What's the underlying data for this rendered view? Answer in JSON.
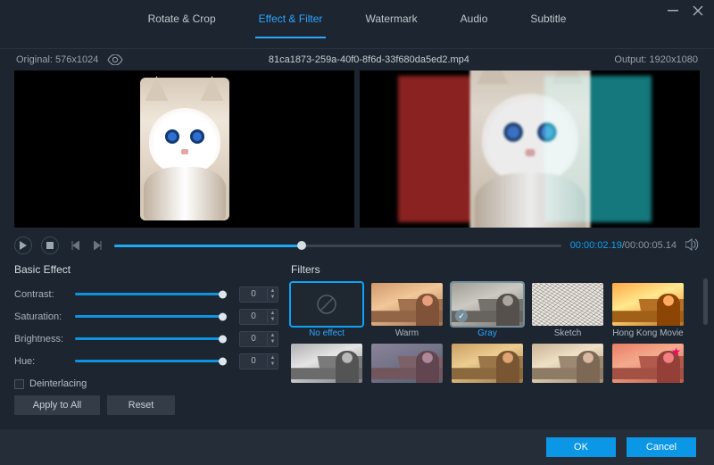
{
  "window": {
    "minimize": "—",
    "close": "✕"
  },
  "tabs": {
    "rotate": "Rotate & Crop",
    "effect": "Effect & Filter",
    "watermark": "Watermark",
    "audio": "Audio",
    "subtitle": "Subtitle"
  },
  "info": {
    "original_label": "Original: 576x1024",
    "filename": "81ca1873-259a-40f0-8f6d-33f680da5ed2.mp4",
    "output_label": "Output: 1920x1080"
  },
  "playback": {
    "current_time": "00:00:02.19",
    "total_time": "/00:00:05.14",
    "progress_pct": 42
  },
  "basic": {
    "title": "Basic Effect",
    "contrast_label": "Contrast:",
    "contrast_value": "0",
    "saturation_label": "Saturation:",
    "saturation_value": "0",
    "brightness_label": "Brightness:",
    "brightness_value": "0",
    "hue_label": "Hue:",
    "hue_value": "0",
    "deinterlacing_label": "Deinterlacing",
    "apply_label": "Apply to All",
    "reset_label": "Reset"
  },
  "filters": {
    "title": "Filters",
    "noeffect": "No effect",
    "warm": "Warm",
    "gray": "Gray",
    "sketch": "Sketch",
    "hkm": "Hong Kong Movie"
  },
  "footer": {
    "ok": "OK",
    "cancel": "Cancel"
  }
}
